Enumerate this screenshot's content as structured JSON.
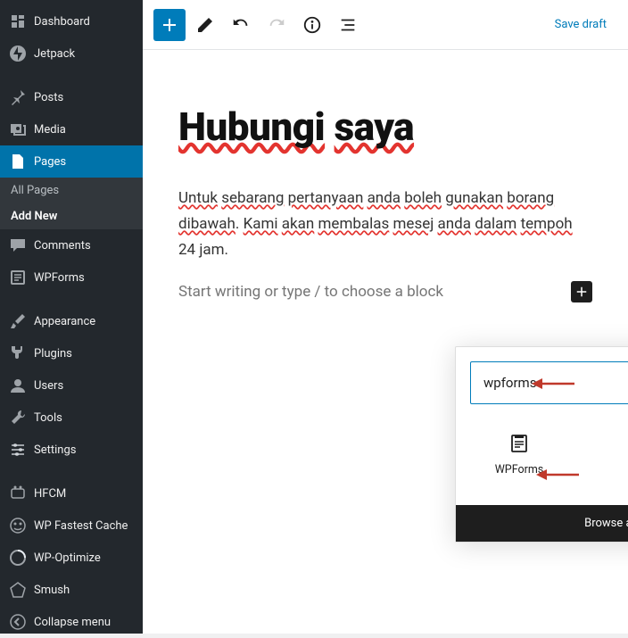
{
  "sidebar": {
    "items": [
      {
        "label": "Dashboard",
        "icon": "dashboard-icon"
      },
      {
        "label": "Jetpack",
        "icon": "jetpack-icon"
      },
      {
        "label": "Posts",
        "icon": "pin-icon"
      },
      {
        "label": "Media",
        "icon": "media-icon"
      },
      {
        "label": "Pages",
        "icon": "page-icon",
        "active": true
      },
      {
        "label": "Comments",
        "icon": "comment-icon"
      },
      {
        "label": "WPForms",
        "icon": "form-icon"
      },
      {
        "label": "Appearance",
        "icon": "brush-icon"
      },
      {
        "label": "Plugins",
        "icon": "plug-icon"
      },
      {
        "label": "Users",
        "icon": "user-icon"
      },
      {
        "label": "Tools",
        "icon": "wrench-icon"
      },
      {
        "label": "Settings",
        "icon": "sliders-icon"
      },
      {
        "label": "HFCM",
        "icon": "hfcm-icon"
      },
      {
        "label": "WP Fastest Cache",
        "icon": "cache-icon"
      },
      {
        "label": "WP-Optimize",
        "icon": "optimize-icon"
      },
      {
        "label": "Smush",
        "icon": "smush-icon"
      }
    ],
    "sub": {
      "all": "All Pages",
      "add": "Add New"
    },
    "collapse": "Collapse menu"
  },
  "toolbar": {
    "save_draft": "Save draft"
  },
  "editor": {
    "title_parts": [
      "Hubungi",
      " ",
      "saya"
    ],
    "paragraph_plain": "Untuk sebarang pertanyaan anda boleh gunakan borang dibawah. Kami akan membalas mesej anda dalam tempoh 24 jam.",
    "placeholder": "Start writing or type / to choose a block"
  },
  "popover": {
    "search_value": "wpforms",
    "result_label": "WPForms",
    "browse": "Browse all"
  }
}
